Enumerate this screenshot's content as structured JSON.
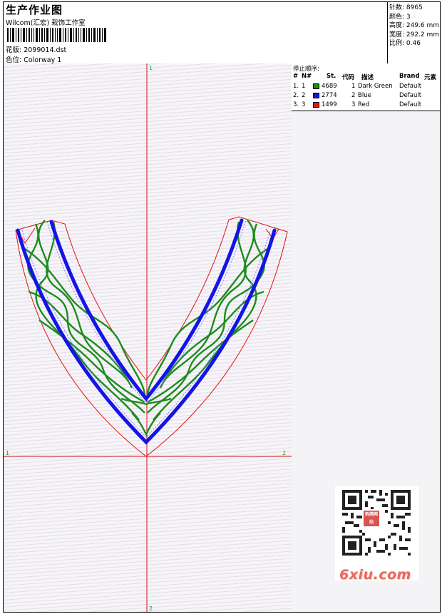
{
  "header": {
    "title": "生产作业图",
    "subtitle": "Wilcom(汇宏) 栽饰工作室",
    "design_label": "花版: 2099014.dst",
    "colorway_label": "色位: Colorway 1"
  },
  "stats": {
    "stitches": "针数: 8965",
    "colors": "颜色: 3",
    "height": "高度: 249.6 mm",
    "width": "宽度: 292.2 mm",
    "scale": "比例: 0.46"
  },
  "stop_sequence": {
    "title": "停止顺序:",
    "headers": {
      "hash": "#",
      "n": "N#",
      "st": "St.",
      "code": "代码",
      "desc": "描述",
      "brand": "Brand",
      "element": "元素"
    },
    "rows": [
      {
        "num": "1.",
        "n": "1",
        "color": "#1c8c1c",
        "st": "4689",
        "code": "1",
        "desc": "Dark Green",
        "brand": "Default"
      },
      {
        "num": "2.",
        "n": "2",
        "color": "#1414e6",
        "st": "2774",
        "code": "2",
        "desc": "Blue",
        "brand": "Default"
      },
      {
        "num": "3.",
        "n": "3",
        "color": "#e61414",
        "st": "1499",
        "code": "3",
        "desc": "Red",
        "brand": "Default"
      }
    ]
  },
  "axes": {
    "top": "1",
    "bottom": "2",
    "left": "1",
    "right": "2",
    "axis_color": "#d01010",
    "label_color": "#10a010"
  },
  "watermark": {
    "text": "6xiu.com",
    "stamp": "刺绣网站"
  }
}
